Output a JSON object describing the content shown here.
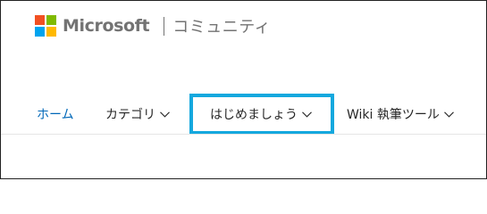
{
  "brand": {
    "name": "Microsoft",
    "subtitle": "コミュニティ",
    "logo_colors": [
      "#f25022",
      "#7fba00",
      "#00a4ef",
      "#ffb900"
    ]
  },
  "nav": {
    "items": [
      {
        "label": "ホーム",
        "has_dropdown": false,
        "state": "link"
      },
      {
        "label": "カテゴリ",
        "has_dropdown": true,
        "icon": "chevron-down-icon"
      },
      {
        "label": "はじめましょう",
        "has_dropdown": true,
        "icon": "chevron-down-icon",
        "state": "highlighted"
      },
      {
        "label": "Wiki 執筆ツール",
        "has_dropdown": true,
        "icon": "chevron-down-icon"
      }
    ]
  },
  "colors": {
    "link": "#0067b8",
    "highlight_border": "#14a8de",
    "text": "#262626",
    "brand_gray": "#737373"
  }
}
